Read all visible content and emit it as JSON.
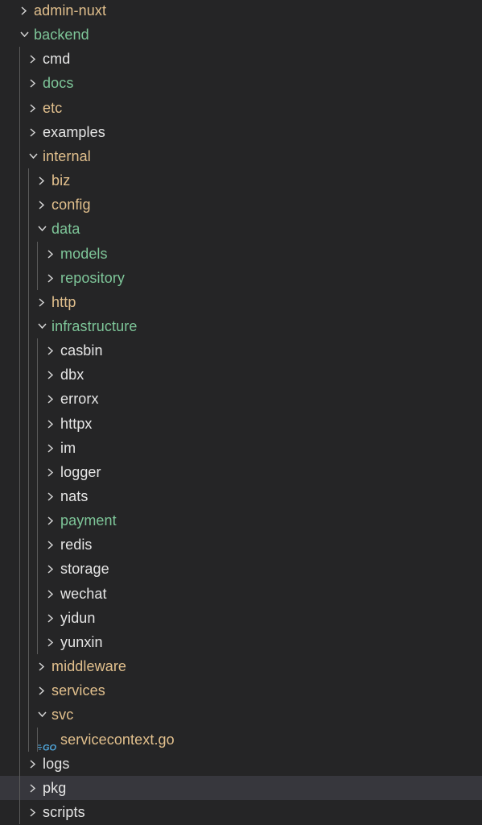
{
  "explorer": {
    "colors": {
      "folder_default": "#e6e6e6",
      "folder_untracked": "#7ec699",
      "folder_modified": "#e2c08d",
      "chevron": "#d4d4d4",
      "go_icon": "#4fa3d6",
      "selected_row_bg": "#37373d",
      "indent_guide": "#5a5a5a"
    },
    "selected_index": 32,
    "items": [
      {
        "label": "admin-nuxt",
        "depth": 0,
        "expanded": false,
        "type": "folder",
        "color": "#e2c08d"
      },
      {
        "label": "backend",
        "depth": 0,
        "expanded": true,
        "type": "folder",
        "color": "#7ec699"
      },
      {
        "label": "cmd",
        "depth": 1,
        "expanded": false,
        "type": "folder",
        "color": "#e6e6e6"
      },
      {
        "label": "docs",
        "depth": 1,
        "expanded": false,
        "type": "folder",
        "color": "#7ec699"
      },
      {
        "label": "etc",
        "depth": 1,
        "expanded": false,
        "type": "folder",
        "color": "#e2c08d"
      },
      {
        "label": "examples",
        "depth": 1,
        "expanded": false,
        "type": "folder",
        "color": "#e6e6e6"
      },
      {
        "label": "internal",
        "depth": 1,
        "expanded": true,
        "type": "folder",
        "color": "#e2c08d"
      },
      {
        "label": "biz",
        "depth": 2,
        "expanded": false,
        "type": "folder",
        "color": "#e2c08d"
      },
      {
        "label": "config",
        "depth": 2,
        "expanded": false,
        "type": "folder",
        "color": "#e2c08d"
      },
      {
        "label": "data",
        "depth": 2,
        "expanded": true,
        "type": "folder",
        "color": "#7ec699"
      },
      {
        "label": "models",
        "depth": 3,
        "expanded": false,
        "type": "folder",
        "color": "#7ec699"
      },
      {
        "label": "repository",
        "depth": 3,
        "expanded": false,
        "type": "folder",
        "color": "#7ec699"
      },
      {
        "label": "http",
        "depth": 2,
        "expanded": false,
        "type": "folder",
        "color": "#e2c08d"
      },
      {
        "label": "infrastructure",
        "depth": 2,
        "expanded": true,
        "type": "folder",
        "color": "#7ec699"
      },
      {
        "label": "casbin",
        "depth": 3,
        "expanded": false,
        "type": "folder",
        "color": "#e6e6e6"
      },
      {
        "label": "dbx",
        "depth": 3,
        "expanded": false,
        "type": "folder",
        "color": "#e6e6e6"
      },
      {
        "label": "errorx",
        "depth": 3,
        "expanded": false,
        "type": "folder",
        "color": "#e6e6e6"
      },
      {
        "label": "httpx",
        "depth": 3,
        "expanded": false,
        "type": "folder",
        "color": "#e6e6e6"
      },
      {
        "label": "im",
        "depth": 3,
        "expanded": false,
        "type": "folder",
        "color": "#e6e6e6"
      },
      {
        "label": "logger",
        "depth": 3,
        "expanded": false,
        "type": "folder",
        "color": "#e6e6e6"
      },
      {
        "label": "nats",
        "depth": 3,
        "expanded": false,
        "type": "folder",
        "color": "#e6e6e6"
      },
      {
        "label": "payment",
        "depth": 3,
        "expanded": false,
        "type": "folder",
        "color": "#7ec699"
      },
      {
        "label": "redis",
        "depth": 3,
        "expanded": false,
        "type": "folder",
        "color": "#e6e6e6"
      },
      {
        "label": "storage",
        "depth": 3,
        "expanded": false,
        "type": "folder",
        "color": "#e6e6e6"
      },
      {
        "label": "wechat",
        "depth": 3,
        "expanded": false,
        "type": "folder",
        "color": "#e6e6e6"
      },
      {
        "label": "yidun",
        "depth": 3,
        "expanded": false,
        "type": "folder",
        "color": "#e6e6e6"
      },
      {
        "label": "yunxin",
        "depth": 3,
        "expanded": false,
        "type": "folder",
        "color": "#e6e6e6"
      },
      {
        "label": "middleware",
        "depth": 2,
        "expanded": false,
        "type": "folder",
        "color": "#e2c08d"
      },
      {
        "label": "services",
        "depth": 2,
        "expanded": false,
        "type": "folder",
        "color": "#e2c08d"
      },
      {
        "label": "svc",
        "depth": 2,
        "expanded": true,
        "type": "folder",
        "color": "#e2c08d"
      },
      {
        "label": "servicecontext.go",
        "depth": 3,
        "expanded": false,
        "type": "file",
        "icon": "go-file-icon",
        "color": "#e2c08d"
      },
      {
        "label": "logs",
        "depth": 1,
        "expanded": false,
        "type": "folder",
        "color": "#e6e6e6"
      },
      {
        "label": "pkg",
        "depth": 1,
        "expanded": false,
        "type": "folder",
        "color": "#e6e6e6"
      },
      {
        "label": "scripts",
        "depth": 1,
        "expanded": false,
        "type": "folder",
        "color": "#e6e6e6"
      }
    ]
  }
}
